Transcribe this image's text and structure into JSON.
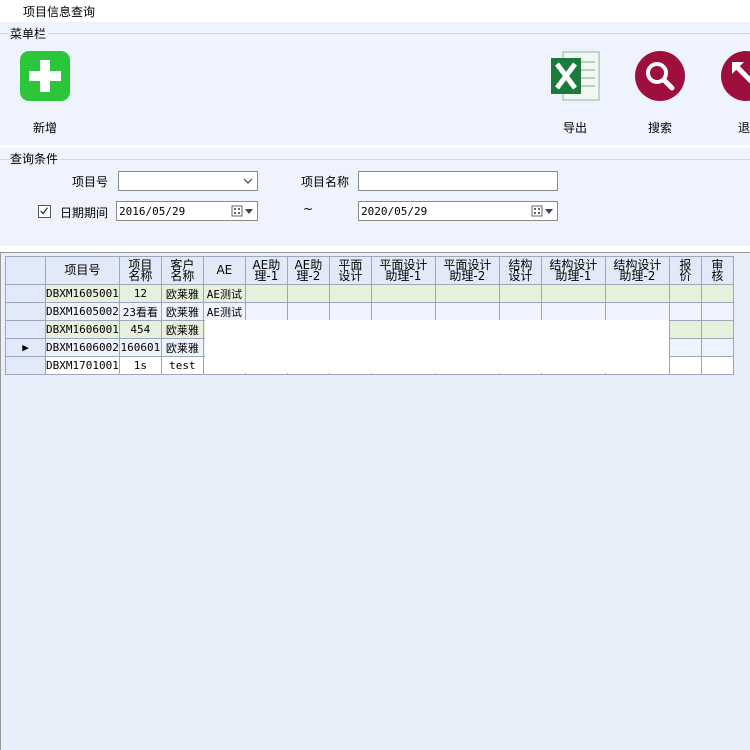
{
  "window": {
    "title": "项目信息查询"
  },
  "menu": {
    "group_label": "菜单栏",
    "buttons": [
      {
        "label": "新增",
        "icon": "add-icon",
        "color": "#2cc63a"
      },
      {
        "label": "导出",
        "icon": "excel-icon",
        "color": "#1d7a3d"
      },
      {
        "label": "搜索",
        "icon": "search-icon",
        "color": "#9e0f3d"
      },
      {
        "label": "退出",
        "icon": "exit-icon",
        "color": "#9e0f3d"
      }
    ]
  },
  "query": {
    "group_label": "查询条件",
    "project_no_label": "项目号",
    "project_no_value": "",
    "project_name_label": "项目名称",
    "project_name_value": "",
    "date_range_label": "日期期间",
    "date_range_checked": true,
    "date_from": "2016/05/29",
    "date_separator": "~",
    "date_to": "2020/05/29"
  },
  "grid": {
    "columns": [
      {
        "l1": "项目号",
        "l2": ""
      },
      {
        "l1": "项目",
        "l2": "名称"
      },
      {
        "l1": "客户",
        "l2": "名称"
      },
      {
        "l1": "AE",
        "l2": ""
      },
      {
        "l1": "AE助",
        "l2": "理-1"
      },
      {
        "l1": "AE助",
        "l2": "理-2"
      },
      {
        "l1": "平面",
        "l2": "设计"
      },
      {
        "l1": "平面设计",
        "l2": "助理-1"
      },
      {
        "l1": "平面设计",
        "l2": "助理-2"
      },
      {
        "l1": "结构",
        "l2": "设计"
      },
      {
        "l1": "结构设计",
        "l2": "助理-1"
      },
      {
        "l1": "结构设计",
        "l2": "助理-2"
      },
      {
        "l1": "报",
        "l2": "价"
      },
      {
        "l1": "审",
        "l2": "核"
      }
    ],
    "rows": [
      {
        "marker": "",
        "cells": [
          "DBXM1605001",
          "12",
          "欧莱雅",
          "AE测试",
          "",
          "",
          "",
          "",
          "",
          "",
          "",
          "",
          "",
          ""
        ]
      },
      {
        "marker": "",
        "cells": [
          "DBXM1605002",
          "23看看",
          "欧莱雅",
          "AE测试",
          "",
          "",
          "",
          "",
          "",
          "",
          "",
          "",
          "",
          ""
        ]
      },
      {
        "marker": "",
        "cells": [
          "DBXM1606001",
          "454",
          "欧莱雅",
          "",
          "",
          "",
          "",
          "",
          "",
          "",
          "",
          "",
          "",
          ""
        ]
      },
      {
        "marker": "▶",
        "cells": [
          "DBXM1606002",
          "160601",
          "欧莱雅",
          "",
          "",
          "",
          "",
          "",
          "",
          "",
          "",
          "",
          "",
          ""
        ]
      },
      {
        "marker": "",
        "cells": [
          "DBXM1701001",
          "1s",
          "test",
          "",
          "",
          "",
          "",
          "",
          "",
          "",
          "",
          "",
          "",
          ""
        ]
      }
    ]
  }
}
